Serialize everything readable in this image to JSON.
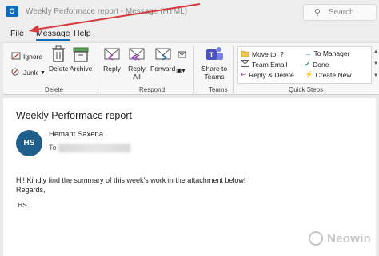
{
  "window": {
    "title": "Weekly Performace report - Message (HTML)",
    "search_placeholder": "Search"
  },
  "menu": [
    "File",
    "Message",
    "Help"
  ],
  "ribbon": {
    "delete_group": {
      "label": "Delete",
      "ignore": "Ignore",
      "junk": "Junk",
      "delete": "Delete",
      "archive": "Archive"
    },
    "respond_group": {
      "label": "Respond",
      "reply": "Reply",
      "reply_all_1": "Reply",
      "reply_all_2": "All",
      "forward": "Forward"
    },
    "teams_group": {
      "label": "Teams",
      "share_1": "Share to",
      "share_2": "Teams"
    },
    "quick_steps": {
      "label": "Quick Steps",
      "items": [
        "Move to: ?",
        "To Manager",
        "Team Email",
        "Done",
        "Reply & Delete",
        "Create New"
      ]
    }
  },
  "message": {
    "subject": "Weekly Performace report",
    "avatar_initials": "HS",
    "sender": "Hemant Saxena",
    "to_label": "To",
    "body_lines": [
      "Hi! Kindly find the summary of this week's work in the attachment below!",
      "Regards,"
    ],
    "signature": "HS"
  },
  "watermark": "Neowin",
  "colors": {
    "accent": "#0f6cbd",
    "avatar": "#1f5f8b",
    "annotation_arrow": "#d63a3a"
  }
}
